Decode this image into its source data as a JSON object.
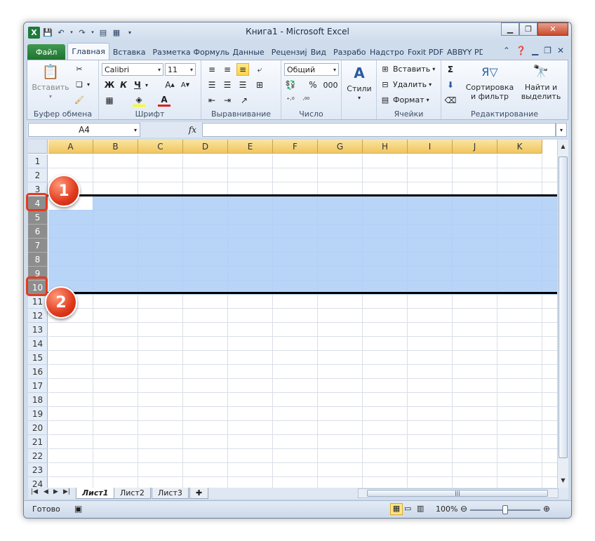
{
  "window": {
    "title": "Книга1 - Microsoft Excel"
  },
  "ribbon_tabs": [
    {
      "label": "Файл"
    },
    {
      "label": "Главная"
    },
    {
      "label": "Вставка"
    },
    {
      "label": "Разметка"
    },
    {
      "label": "Формулы"
    },
    {
      "label": "Данные"
    },
    {
      "label": "Рецензиј"
    },
    {
      "label": "Вид"
    },
    {
      "label": "Разрабо"
    },
    {
      "label": "Надстро"
    },
    {
      "label": "Foxit PDF"
    },
    {
      "label": "ABBYY PD"
    }
  ],
  "clipboard": {
    "paste": "Вставить",
    "label": "Буфер обмена"
  },
  "font": {
    "name": "Calibri",
    "size": "11",
    "bold": "Ж",
    "italic": "К",
    "underline": "Ч",
    "label": "Шрифт"
  },
  "alignment": {
    "label": "Выравнивание"
  },
  "number": {
    "format": "Общий",
    "percent": "%",
    "thousands": "000",
    "label": "Число"
  },
  "styles": {
    "label": "Стили"
  },
  "cells_group": {
    "insert": "Вставить",
    "delete": "Удалить",
    "format": "Формат",
    "label": "Ячейки"
  },
  "editing": {
    "sort_line1": "Сортировка",
    "sort_line2": "и фильтр",
    "find_line1": "Найти и",
    "find_line2": "выделить",
    "label": "Редактирование"
  },
  "formula_bar": {
    "name_box": "A4",
    "fx": "fx",
    "value": ""
  },
  "grid": {
    "columns": [
      "A",
      "B",
      "C",
      "D",
      "E",
      "F",
      "G",
      "H",
      "I",
      "J",
      "K"
    ],
    "rows": [
      "1",
      "2",
      "3",
      "4",
      "5",
      "6",
      "7",
      "8",
      "9",
      "10",
      "11",
      "12",
      "13",
      "14",
      "15",
      "16",
      "17",
      "18",
      "19",
      "20",
      "21",
      "22",
      "23",
      "24"
    ],
    "selected_rows": [
      "4",
      "5",
      "6",
      "7",
      "8",
      "9",
      "10"
    ]
  },
  "callouts": [
    {
      "label": "1"
    },
    {
      "label": "2"
    }
  ],
  "sheets": [
    {
      "label": "Лист1"
    },
    {
      "label": "Лист2"
    },
    {
      "label": "Лист3"
    }
  ],
  "status": {
    "ready": "Готово",
    "zoom": "100%",
    "zoom_value": 100
  },
  "colors": {
    "accent_green": "#1f7331",
    "column_header": "#f2c55c",
    "selection": "#acceef7",
    "callout": "#e0391c"
  }
}
